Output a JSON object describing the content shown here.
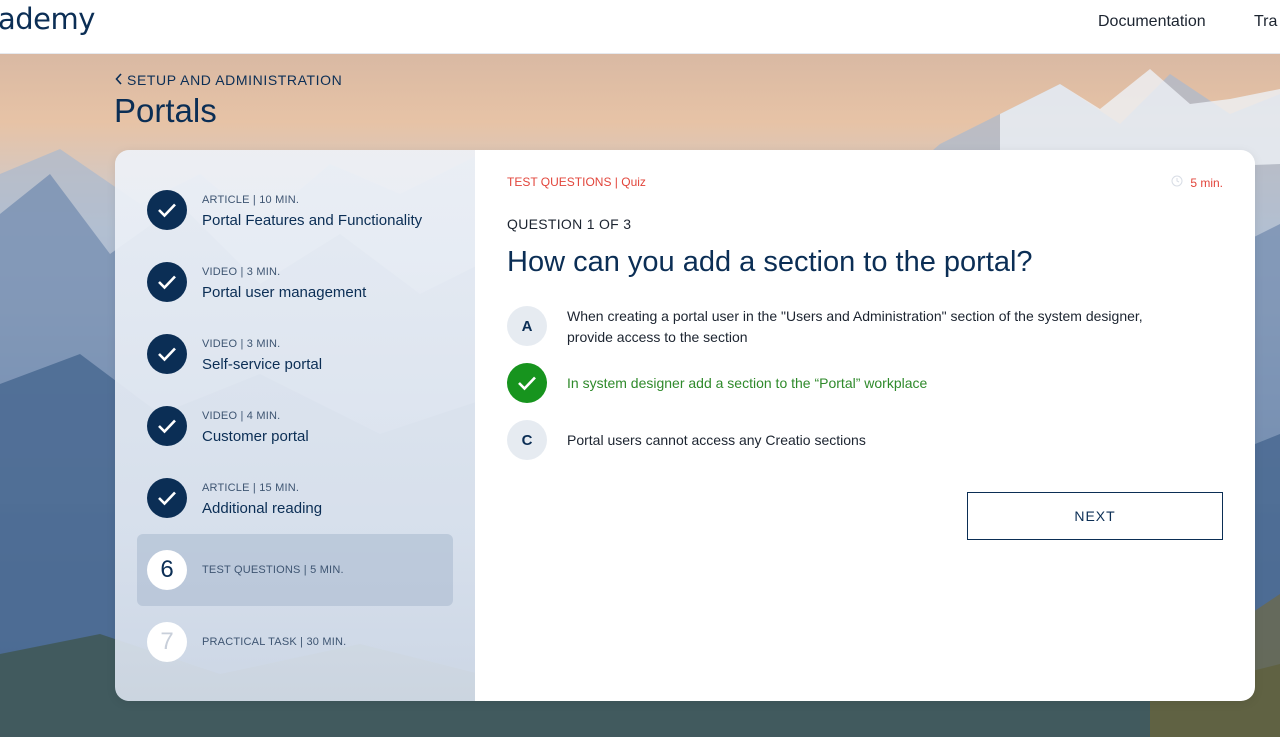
{
  "header": {
    "logo_text": "ademy",
    "nav": [
      "Documentation",
      "Tra"
    ]
  },
  "breadcrumb": {
    "label": "SETUP AND ADMINISTRATION"
  },
  "page": {
    "title": "Portals"
  },
  "steps": [
    {
      "meta": "ARTICLE | 10 MIN.",
      "name": "Portal Features and Functionality",
      "status": "completed"
    },
    {
      "meta": "VIDEO | 3 MIN.",
      "name": "Portal user management",
      "status": "completed"
    },
    {
      "meta": "VIDEO | 3 MIN.",
      "name": "Self-service portal",
      "status": "completed"
    },
    {
      "meta": "VIDEO | 4 MIN.",
      "name": "Customer portal",
      "status": "completed"
    },
    {
      "meta": "ARTICLE | 15 MIN.",
      "name": "Additional reading",
      "status": "completed"
    },
    {
      "number": "6",
      "meta": "TEST QUESTIONS | 5 MIN.",
      "status": "active"
    },
    {
      "number": "7",
      "meta": "PRACTICAL TASK | 30 MIN.",
      "status": "locked"
    }
  ],
  "quiz": {
    "type_label": "TEST QUESTIONS | Quiz",
    "duration": "5 min.",
    "counter": "QUESTION 1 OF 3",
    "question": "How can you add a section to the portal?",
    "options": [
      {
        "letter": "A",
        "lines": [
          "When creating a portal user in the \"Users and Administration\" section of the system designer,",
          "provide access to the section"
        ],
        "correct": false
      },
      {
        "letter": "B",
        "lines": [
          "In system designer add a section to the “Portal” workplace"
        ],
        "correct": true
      },
      {
        "letter": "C",
        "lines": [
          "Portal users cannot  access any Creatio sections"
        ],
        "correct": false
      }
    ],
    "next_label": "NEXT"
  },
  "colors": {
    "brand_navy": "#0b2e55",
    "accent_red": "#e2453b",
    "correct_green": "#17941e",
    "correct_text": "#2f8a2b"
  },
  "icons": {
    "back": "chevron-left-icon",
    "completed": "check-icon",
    "duration": "clock-icon"
  }
}
